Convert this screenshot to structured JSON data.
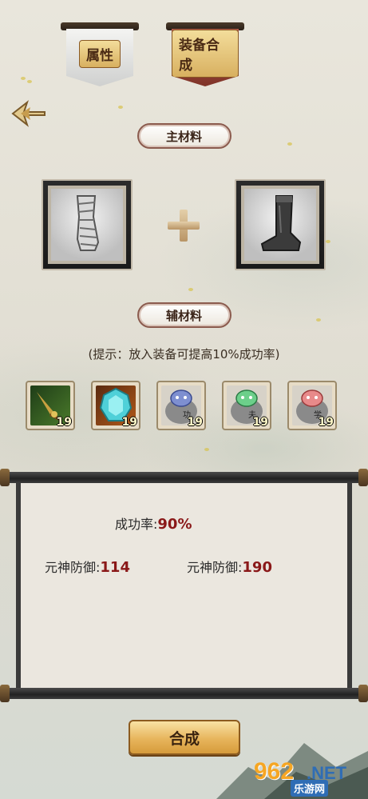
{
  "tabs": [
    {
      "label": "属性"
    },
    {
      "label": "装备合成"
    }
  ],
  "main_materials": {
    "title": "主材料",
    "slots": [
      {
        "icon": "bandaged-leggings-icon"
      },
      {
        "icon": "dark-boot-icon"
      }
    ]
  },
  "sub_materials": {
    "title": "辅材料",
    "hint": "(提示：放入装备可提高10%成功率)",
    "items": [
      {
        "icon": "dragon-sword-icon",
        "count": "19"
      },
      {
        "icon": "cyan-crystal-icon",
        "count": "19"
      },
      {
        "icon": "blue-beast-stone-icon",
        "glyph": "功",
        "count": "19"
      },
      {
        "icon": "green-beast-stone-icon",
        "glyph": "夫",
        "count": "19"
      },
      {
        "icon": "red-beast-stone-icon",
        "glyph": "学",
        "count": "19"
      }
    ]
  },
  "result": {
    "success_rate_label": "成功率:",
    "success_rate_value": "90%",
    "stat_before_label": "元神防御:",
    "stat_before_value": "114",
    "stat_after_label": "元神防御:",
    "stat_after_value": "190"
  },
  "synthesize_button": "合成",
  "watermark": {
    "number": "962",
    "net": ".NET",
    "text": "乐游网"
  },
  "colors": {
    "stat_value": "#8a1818",
    "button": "#e7b55c",
    "tab_active": "#9a4538"
  }
}
